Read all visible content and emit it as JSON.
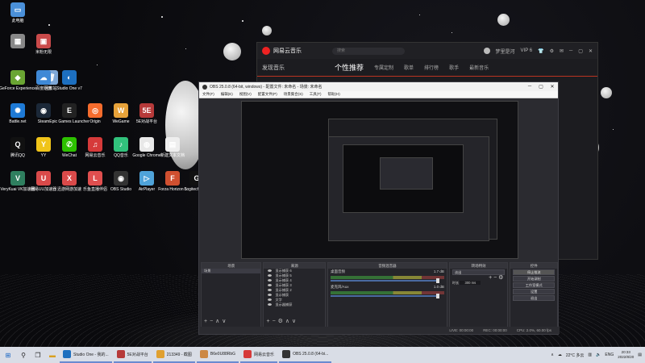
{
  "desktop": {
    "icons": [
      {
        "label": "此电脑",
        "color": "#4a90d9",
        "glyph": "▭"
      },
      {
        "label": "回收站",
        "color": "#7fa8d8",
        "glyph": "🗑"
      },
      {
        "label": "",
        "color": "#888",
        "glyph": "▦"
      },
      {
        "label": "米粉无限",
        "color": "#c94a4a",
        "glyph": "▣"
      },
      {
        "label": "GeForce Experience",
        "color": "#6aa533",
        "glyph": "◆"
      },
      {
        "label": "百度网盘",
        "color": "#3f89d6",
        "glyph": "☁"
      },
      {
        "label": "Studio One v7",
        "color": "#1d6fbf",
        "glyph": "◐"
      },
      {
        "label": "Battle.net",
        "color": "#1e7ad6",
        "glyph": "✺"
      },
      {
        "label": "Steam",
        "color": "#1b2838",
        "glyph": "◉"
      },
      {
        "label": "Epic Games Launcher",
        "color": "#222",
        "glyph": "E"
      },
      {
        "label": "Origin",
        "color": "#f56c2d",
        "glyph": "◎"
      },
      {
        "label": "WeGame",
        "color": "#e8a33a",
        "glyph": "W"
      },
      {
        "label": "5E对战平台",
        "color": "#b63a3a",
        "glyph": "5E"
      },
      {
        "label": "腾讯QQ",
        "color": "#111",
        "glyph": "Q"
      },
      {
        "label": "YY",
        "color": "#f0c419",
        "glyph": "Y"
      },
      {
        "label": "WeChat",
        "color": "#2dc100",
        "glyph": "✆"
      },
      {
        "label": "网易云音乐",
        "color": "#d63a3a",
        "glyph": "♫"
      },
      {
        "label": "QQ音乐",
        "color": "#31c27c",
        "glyph": "♪"
      },
      {
        "label": "Google Chrome",
        "color": "#e8e8e8",
        "glyph": "◍"
      },
      {
        "label": "新建文本文档",
        "color": "#eee",
        "glyph": "▤"
      },
      {
        "label": "VeryKuai VK加速器",
        "color": "#2f7f5f",
        "glyph": "V"
      },
      {
        "label": "网易UU加速器",
        "color": "#d94a4a",
        "glyph": "U"
      },
      {
        "label": "迅游网游加速",
        "color": "#d94a4a",
        "glyph": "X"
      },
      {
        "label": "乐鱼直播伴侣",
        "color": "#e04f4f",
        "glyph": "L"
      },
      {
        "label": "OBS Studio",
        "color": "#333",
        "glyph": "◉"
      },
      {
        "label": "AirPlayer",
        "color": "#4fa3d9",
        "glyph": "▷"
      },
      {
        "label": "Forza Horizon 5",
        "color": "#d05030",
        "glyph": "F"
      },
      {
        "label": "Logitech HUB",
        "color": "#111",
        "glyph": "G"
      }
    ]
  },
  "music": {
    "title": "网易云音乐",
    "search_placeholder": "搜索",
    "user": "梦里是河",
    "vip": "VIP 6",
    "nav_left": "发现音乐",
    "tabs": [
      "个性推荐",
      "专属定制",
      "歌单",
      "排行榜",
      "歌手",
      "最新音乐"
    ]
  },
  "obs": {
    "title": "OBS 25.0.8 (64-bit, windows) - 配置文件: 未命名 - 场景: 未命名",
    "menu": [
      "文件(F)",
      "编辑(E)",
      "视图(V)",
      "配置文件(P)",
      "场景集合(S)",
      "工具(T)",
      "帮助(H)"
    ],
    "docks": {
      "scenes": {
        "title": "场景",
        "items": [
          "场景"
        ]
      },
      "sources": {
        "title": "来源",
        "items": [
          "显示捕获 6",
          "显示捕获 5",
          "显示捕获 4",
          "显示捕获 3",
          "显示捕获 2",
          "显示捕获",
          "文字",
          "显示器捕获"
        ]
      },
      "mixer": {
        "title": "音频混音器",
        "tracks": [
          {
            "name": "桌面音频",
            "db": "1.7 dB"
          },
          {
            "name": "麦克风/Aux",
            "db": "1.0 dB"
          }
        ]
      },
      "transitions": {
        "title": "转场特效",
        "type": "淡出",
        "duration_label": "时长",
        "duration": "300 ms"
      },
      "controls": {
        "title": "控件",
        "buttons": [
          "停止推流",
          "开始录制",
          "工作室模式",
          "设置",
          "退出"
        ]
      }
    },
    "status": {
      "live": "LIVE: 00:00:00",
      "rec": "REC: 00:00:00",
      "cpu": "CPU: 2.0%, 60.00 fps"
    }
  },
  "taskbar": {
    "apps": [
      {
        "label": "Studio One - 我的...",
        "color": "#1d6fbf"
      },
      {
        "label": "5E对战平台",
        "color": "#b63a3a"
      },
      {
        "label": "213349 - 截图",
        "color": "#e0a030"
      },
      {
        "label": "B6e0U88RbG",
        "color": "#c84"
      },
      {
        "label": "网易云音乐",
        "color": "#d63a3a"
      },
      {
        "label": "OBS 25.0.8 (64-bi...",
        "color": "#333"
      }
    ],
    "weather": "22°C 多云",
    "lang": "ENG",
    "time": "20:33",
    "date": "2022/8/20"
  }
}
